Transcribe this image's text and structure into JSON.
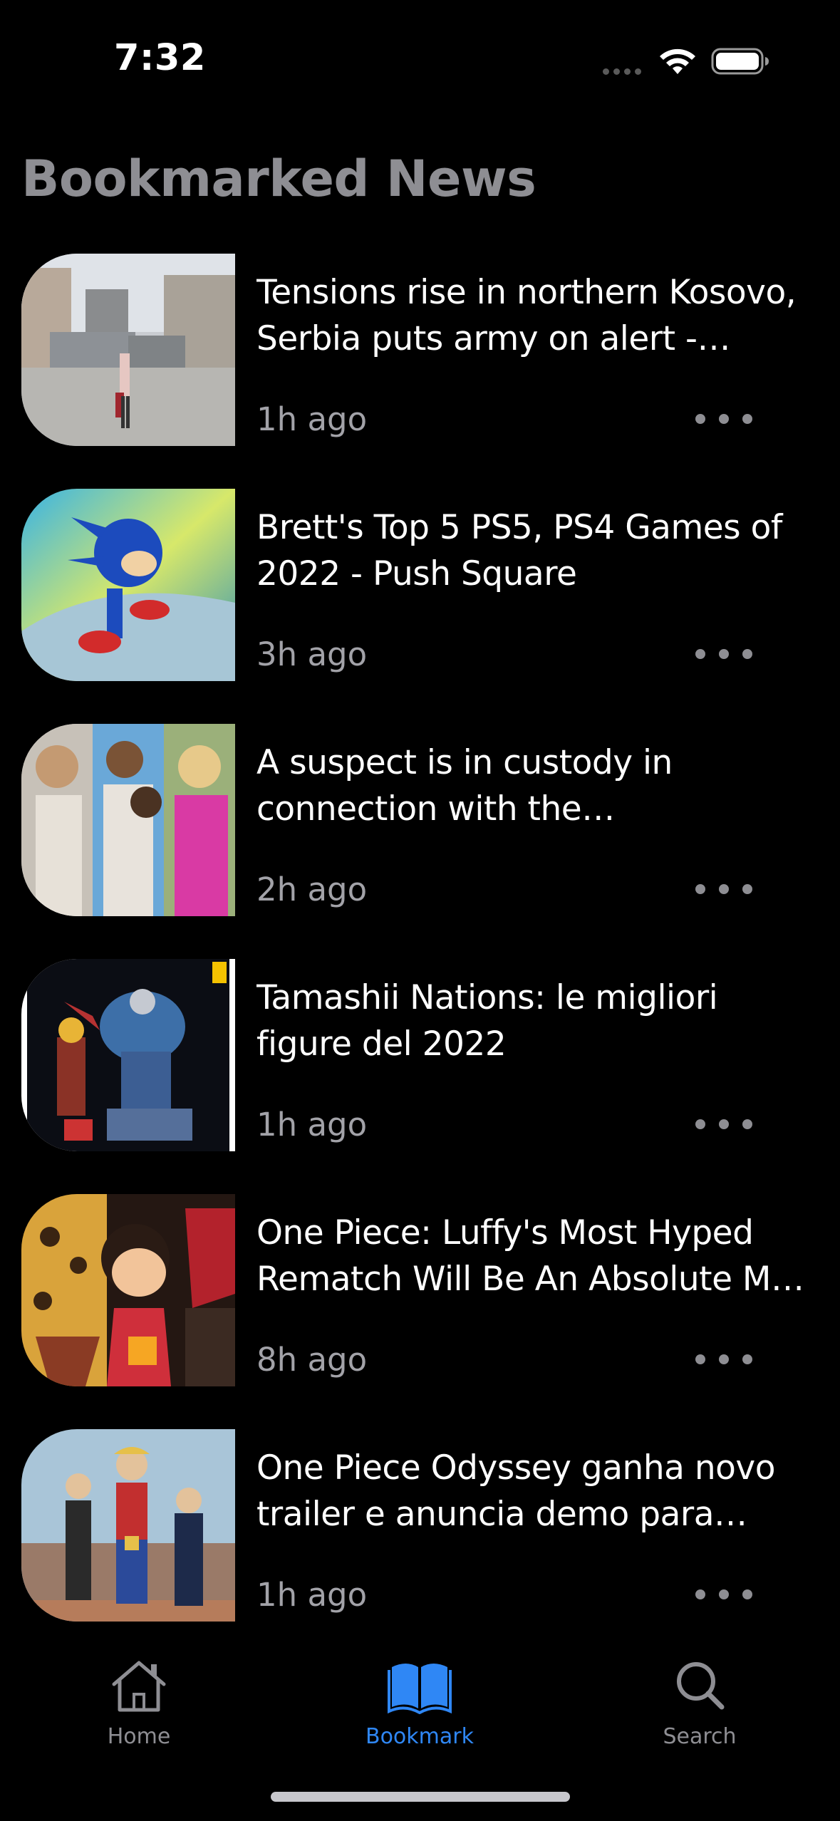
{
  "status_bar": {
    "time": "7:32",
    "signal_icon": "signal-dots-icon",
    "wifi_icon": "wifi-icon",
    "battery_icon": "battery-icon"
  },
  "page": {
    "title": "Bookmarked News"
  },
  "news": [
    {
      "headline": "Tensions rise in northern Kosovo, Serbia puts army on alert - Reut…",
      "time": "1h ago",
      "image": "kosovo-street-barricade-photo"
    },
    {
      "headline": "Brett's Top 5 PS5, PS4 Games of 2022 - Push Square",
      "time": "3h ago",
      "image": "sonic-game-art"
    },
    {
      "headline": "A suspect is in custody in connection with the investigatio…",
      "time": "2h ago",
      "image": "student-portraits-collage"
    },
    {
      "headline": "Tamashii Nations: le migliori figure del 2022",
      "time": "1h ago",
      "image": "robot-figure-photo"
    },
    {
      "headline": "One Piece: Luffy's Most Hyped Rematch Will Be An Absolute M…",
      "time": "8h ago",
      "image": "one-piece-anime-art"
    },
    {
      "headline": "One Piece Odyssey ganha novo trailer e anuncia demo para janeiro",
      "time": "1h ago",
      "image": "one-piece-odyssey-screenshot"
    }
  ],
  "tab_bar": {
    "tabs": [
      {
        "label": "Home",
        "icon": "house-icon",
        "active": false
      },
      {
        "label": "Bookmark",
        "icon": "book-icon",
        "active": true
      },
      {
        "label": "Search",
        "icon": "magnifying-glass-icon",
        "active": false
      }
    ],
    "active_color": "#2f87f5",
    "inactive_color": "#8e8e93"
  },
  "colors": {
    "background": "#000000",
    "title": "#8e8e93",
    "headline": "#ffffff",
    "secondary_text": "#a2a2a8"
  }
}
